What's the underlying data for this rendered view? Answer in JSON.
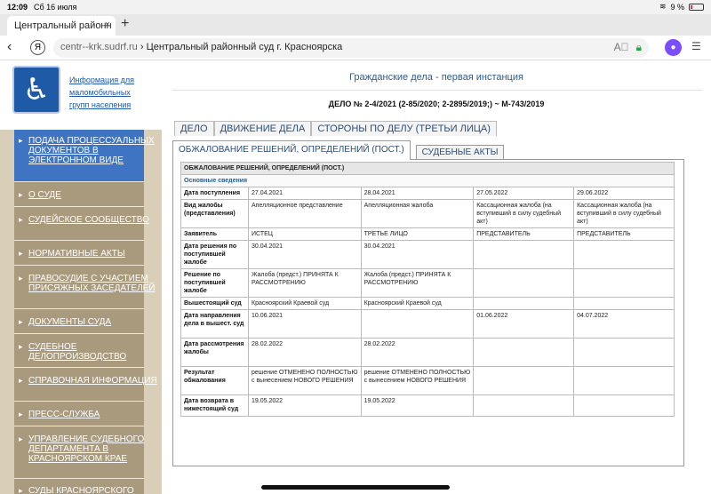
{
  "statusbar": {
    "time": "12:09",
    "date": "Сб 16 июля",
    "battery": "9 %"
  },
  "browser": {
    "tab_title": "Центральный районн",
    "new_tab_icon": "+",
    "url_domain": "centr--krk.sudrf.ru",
    "url_separator": "›",
    "url_title": "Центральный районный суд г. Красноярска"
  },
  "accessibility": {
    "link_text": "Информация для маломобильных групп населения"
  },
  "sidebar": {
    "items": [
      {
        "label": "Подача процессуальных документов в электронном виде"
      },
      {
        "label": "О суде"
      },
      {
        "label": "Судейское сообщество"
      },
      {
        "label": "Нормативные акты"
      },
      {
        "label": "Правосудие с участием присяжных заседателей"
      },
      {
        "label": "Документы суда"
      },
      {
        "label": "Судебное делопроизводство"
      },
      {
        "label": "Справочная информация"
      },
      {
        "label": "Пресс-служба"
      },
      {
        "label": "Управление судебного департамента в Красноярском крае"
      },
      {
        "label": "Суды Красноярского"
      }
    ]
  },
  "main": {
    "title": "Гражданские дела - первая инстанция",
    "case_number": "ДЕЛО № 2-4/2021 (2-85/2020; 2-2895/2019;) ~ М-743/2019",
    "tabs": [
      "ДЕЛО",
      "ДВИЖЕНИЕ ДЕЛА",
      "СТОРОНЫ ПО ДЕЛУ (ТРЕТЬИ ЛИЦА)"
    ],
    "subtabs": [
      "ОБЖАЛОВАНИЕ РЕШЕНИЙ, ОПРЕДЕЛЕНИЙ (ПОСТ.)",
      "СУДЕБНЫЕ АКТЫ"
    ]
  },
  "table": {
    "header": "ОБЖАЛОВАНИЕ РЕШЕНИЙ, ОПРЕДЕЛЕНИЙ (ПОСТ.)",
    "section": "Основные сведения",
    "rows": [
      {
        "label": "Дата поступления",
        "c1": "27.04.2021",
        "c2": "28.04.2021",
        "c3": "27.05.2022",
        "c4": "29.06.2022"
      },
      {
        "label": "Вид жалобы (представления)",
        "c1": "Апелляционное представление",
        "c2": "Апелляционная жалоба",
        "c3": "Кассационная жалоба (на вступивший в силу судебный акт)",
        "c4": "Кассационная жалоба (на вступивший в силу судебный акт)"
      },
      {
        "label": "Заявитель",
        "c1": "ИСТЕЦ",
        "c2": "ТРЕТЬЕ ЛИЦО",
        "c3": "ПРЕДСТАВИТЕЛЬ",
        "c4": "ПРЕДСТАВИТЕЛЬ"
      },
      {
        "label": "Дата решения по поступившей жалобе",
        "c1": "30.04.2021",
        "c2": "30.04.2021",
        "c3": "",
        "c4": ""
      },
      {
        "label": "Решение по поступившей жалобе",
        "c1": "Жалоба (предст.) ПРИНЯТА К РАССМОТРЕНИЮ",
        "c2": "Жалоба (предст.) ПРИНЯТА К РАССМОТРЕНИЮ",
        "c3": "",
        "c4": ""
      },
      {
        "label": "Вышестоящий суд",
        "c1": "Красноярский Краевой суд",
        "c2": "Красноярский Краевой суд",
        "c3": "",
        "c4": ""
      },
      {
        "label": "Дата направления дела в вышест. суд",
        "c1": "10.06.2021",
        "c2": "",
        "c3": "01.06.2022",
        "c4": "04.07.2022"
      },
      {
        "label": "Дата рассмотрения жалобы",
        "c1": "28.02.2022",
        "c2": "28.02.2022",
        "c3": "",
        "c4": ""
      },
      {
        "label": "Результат обжалования",
        "c1": "решение ОТМЕНЕНО ПОЛНОСТЬЮ с вынесением НОВОГО РЕШЕНИЯ",
        "c2": "решение ОТМЕНЕНО ПОЛНОСТЬЮ с вынесением НОВОГО РЕШЕНИЯ",
        "c3": "",
        "c4": ""
      },
      {
        "label": "Дата возврата в нижестоящий суд",
        "c1": "19.05.2022",
        "c2": "19.05.2022",
        "c3": "",
        "c4": ""
      }
    ]
  },
  "colors": {
    "accent": "#3f74c2",
    "sidebar": "#a99a7e",
    "link": "#1f5aa6"
  }
}
